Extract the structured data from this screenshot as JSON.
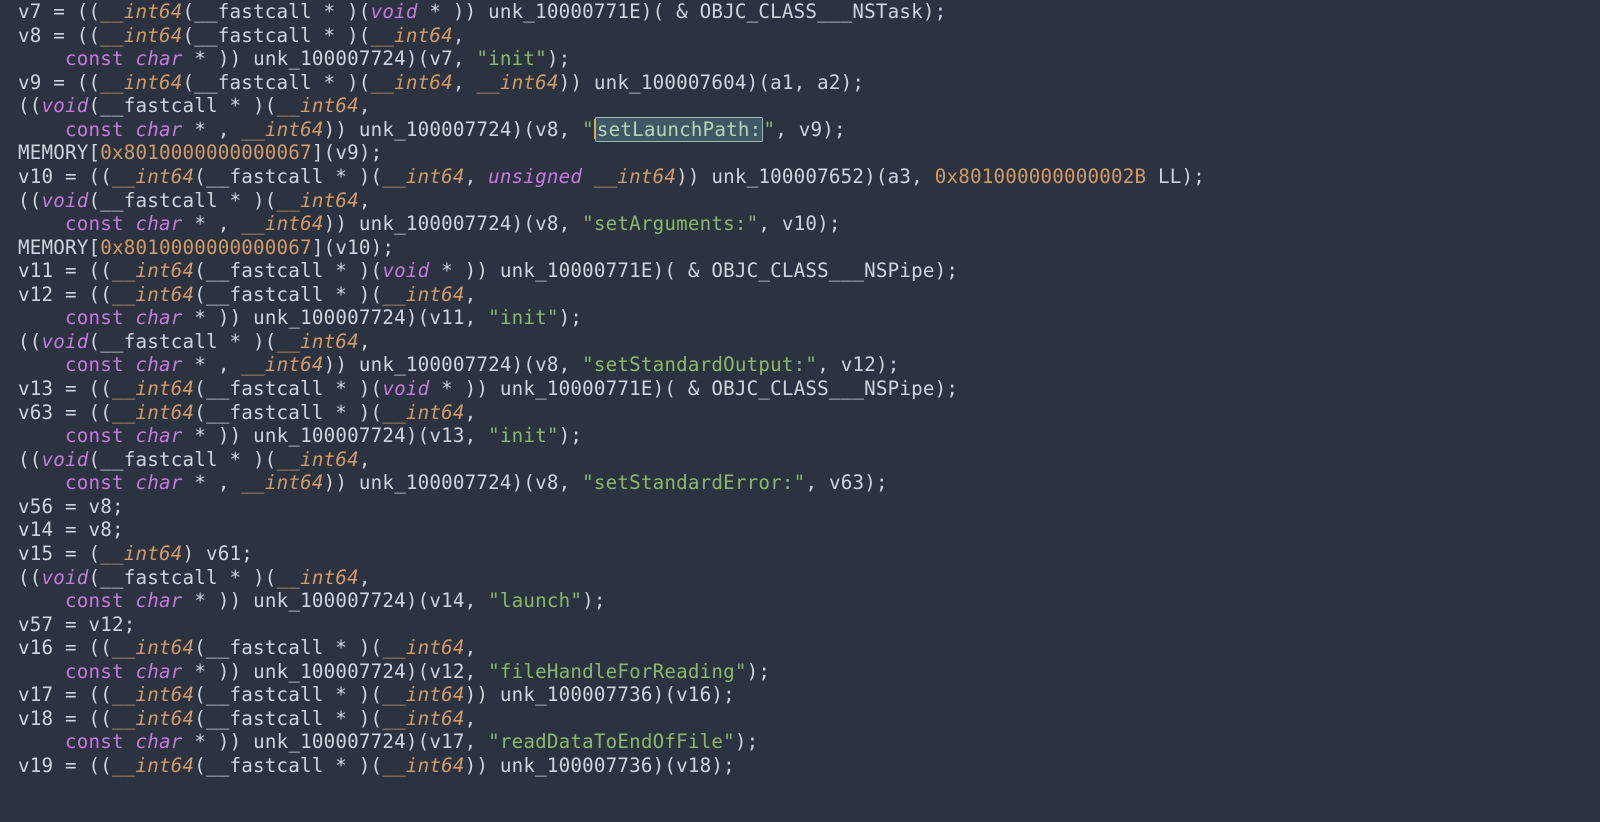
{
  "colors": {
    "background": "#2b3340",
    "foreground": "#cfd4dc",
    "type": "#d19a66",
    "keyword": "#c778dd",
    "string": "#89b86a",
    "number": "#d19a66",
    "highlight_bg": "#3e5866",
    "caret": "#e5a24a"
  },
  "highlighted_text": "setLaunchPath:",
  "code_lines": [
    [
      [
        "default",
        "v7 = (("
      ],
      [
        "type",
        "__int64"
      ],
      [
        "default",
        "(__fastcall * )("
      ],
      [
        "void",
        "void"
      ],
      [
        "default",
        " * )) unk_10000771E)( "
      ],
      [
        "amp",
        "&"
      ],
      [
        "default",
        " OBJC_CLASS___NSTask);"
      ]
    ],
    [
      [
        "default",
        "v8 = (("
      ],
      [
        "type",
        "__int64"
      ],
      [
        "default",
        "(__fastcall * )("
      ],
      [
        "type",
        "__int64"
      ],
      [
        "default",
        ","
      ]
    ],
    [
      [
        "default",
        "    "
      ],
      [
        "kw",
        "const"
      ],
      [
        "default",
        " "
      ],
      [
        "char",
        "char"
      ],
      [
        "default",
        " * )) unk_100007724)(v7, "
      ],
      [
        "str",
        "\"init\""
      ],
      [
        "default",
        ");"
      ]
    ],
    [
      [
        "default",
        "v9 = (("
      ],
      [
        "type",
        "__int64"
      ],
      [
        "default",
        "(__fastcall * )("
      ],
      [
        "type",
        "__int64"
      ],
      [
        "default",
        ", "
      ],
      [
        "type",
        "__int64"
      ],
      [
        "default",
        ")) unk_100007604)(a1, a2);"
      ]
    ],
    [
      [
        "default",
        "(("
      ],
      [
        "void",
        "void"
      ],
      [
        "default",
        "(__fastcall * )("
      ],
      [
        "type",
        "__int64"
      ],
      [
        "default",
        ","
      ]
    ],
    [
      [
        "default",
        "    "
      ],
      [
        "kw",
        "const"
      ],
      [
        "default",
        " "
      ],
      [
        "char",
        "char"
      ],
      [
        "default",
        " * , "
      ],
      [
        "type",
        "__int64"
      ],
      [
        "default",
        ")) unk_100007724)(v8, "
      ],
      [
        "str",
        "\""
      ],
      [
        "caret",
        ""
      ],
      [
        "hl",
        "setLaunchPath:"
      ],
      [
        "str",
        "\""
      ],
      [
        "default",
        ", v9);"
      ]
    ],
    [
      [
        "default",
        "MEMORY["
      ],
      [
        "num",
        "0x8010000000000067"
      ],
      [
        "default",
        "](v9);"
      ]
    ],
    [
      [
        "default",
        "v10 = (("
      ],
      [
        "type",
        "__int64"
      ],
      [
        "default",
        "(__fastcall * )("
      ],
      [
        "type",
        "__int64"
      ],
      [
        "default",
        ", "
      ],
      [
        "unsigned",
        "unsigned"
      ],
      [
        "default",
        " "
      ],
      [
        "type",
        "__int64"
      ],
      [
        "default",
        ")) unk_100007652)(a3, "
      ],
      [
        "num",
        "0x801000000000002B"
      ],
      [
        "default",
        " LL);"
      ]
    ],
    [
      [
        "default",
        "(("
      ],
      [
        "void",
        "void"
      ],
      [
        "default",
        "(__fastcall * )("
      ],
      [
        "type",
        "__int64"
      ],
      [
        "default",
        ","
      ]
    ],
    [
      [
        "default",
        "    "
      ],
      [
        "kw",
        "const"
      ],
      [
        "default",
        " "
      ],
      [
        "char",
        "char"
      ],
      [
        "default",
        " * , "
      ],
      [
        "type",
        "__int64"
      ],
      [
        "default",
        ")) unk_100007724)(v8, "
      ],
      [
        "str",
        "\"setArguments:\""
      ],
      [
        "default",
        ", v10);"
      ]
    ],
    [
      [
        "default",
        "MEMORY["
      ],
      [
        "num",
        "0x8010000000000067"
      ],
      [
        "default",
        "](v10);"
      ]
    ],
    [
      [
        "default",
        "v11 = (("
      ],
      [
        "type",
        "__int64"
      ],
      [
        "default",
        "(__fastcall * )("
      ],
      [
        "void",
        "void"
      ],
      [
        "default",
        " * )) unk_10000771E)( "
      ],
      [
        "amp",
        "&"
      ],
      [
        "default",
        " OBJC_CLASS___NSPipe);"
      ]
    ],
    [
      [
        "default",
        "v12 = (("
      ],
      [
        "type",
        "__int64"
      ],
      [
        "default",
        "(__fastcall * )("
      ],
      [
        "type",
        "__int64"
      ],
      [
        "default",
        ","
      ]
    ],
    [
      [
        "default",
        "    "
      ],
      [
        "kw",
        "const"
      ],
      [
        "default",
        " "
      ],
      [
        "char",
        "char"
      ],
      [
        "default",
        " * )) unk_100007724)(v11, "
      ],
      [
        "str",
        "\"init\""
      ],
      [
        "default",
        ");"
      ]
    ],
    [
      [
        "default",
        "(("
      ],
      [
        "void",
        "void"
      ],
      [
        "default",
        "(__fastcall * )("
      ],
      [
        "type",
        "__int64"
      ],
      [
        "default",
        ","
      ]
    ],
    [
      [
        "default",
        "    "
      ],
      [
        "kw",
        "const"
      ],
      [
        "default",
        " "
      ],
      [
        "char",
        "char"
      ],
      [
        "default",
        " * , "
      ],
      [
        "type",
        "__int64"
      ],
      [
        "default",
        ")) unk_100007724)(v8, "
      ],
      [
        "str",
        "\"setStandardOutput:\""
      ],
      [
        "default",
        ", v12);"
      ]
    ],
    [
      [
        "default",
        "v13 = (("
      ],
      [
        "type",
        "__int64"
      ],
      [
        "default",
        "(__fastcall * )("
      ],
      [
        "void",
        "void"
      ],
      [
        "default",
        " * )) unk_10000771E)( "
      ],
      [
        "amp",
        "&"
      ],
      [
        "default",
        " OBJC_CLASS___NSPipe);"
      ]
    ],
    [
      [
        "default",
        "v63 = (("
      ],
      [
        "type",
        "__int64"
      ],
      [
        "default",
        "(__fastcall * )("
      ],
      [
        "type",
        "__int64"
      ],
      [
        "default",
        ","
      ]
    ],
    [
      [
        "default",
        "    "
      ],
      [
        "kw",
        "const"
      ],
      [
        "default",
        " "
      ],
      [
        "char",
        "char"
      ],
      [
        "default",
        " * )) unk_100007724)(v13, "
      ],
      [
        "str",
        "\"init\""
      ],
      [
        "default",
        ");"
      ]
    ],
    [
      [
        "default",
        "(("
      ],
      [
        "void",
        "void"
      ],
      [
        "default",
        "(__fastcall * )("
      ],
      [
        "type",
        "__int64"
      ],
      [
        "default",
        ","
      ]
    ],
    [
      [
        "default",
        "    "
      ],
      [
        "kw",
        "const"
      ],
      [
        "default",
        " "
      ],
      [
        "char",
        "char"
      ],
      [
        "default",
        " * , "
      ],
      [
        "type",
        "__int64"
      ],
      [
        "default",
        ")) unk_100007724)(v8, "
      ],
      [
        "str",
        "\"setStandardError:\""
      ],
      [
        "default",
        ", v63);"
      ]
    ],
    [
      [
        "default",
        "v56 = v8;"
      ]
    ],
    [
      [
        "default",
        "v14 = v8;"
      ]
    ],
    [
      [
        "default",
        "v15 = ("
      ],
      [
        "type",
        "__int64"
      ],
      [
        "default",
        ") v61;"
      ]
    ],
    [
      [
        "default",
        "(("
      ],
      [
        "void",
        "void"
      ],
      [
        "default",
        "(__fastcall * )("
      ],
      [
        "type",
        "__int64"
      ],
      [
        "default",
        ","
      ]
    ],
    [
      [
        "default",
        "    "
      ],
      [
        "kw",
        "const"
      ],
      [
        "default",
        " "
      ],
      [
        "char",
        "char"
      ],
      [
        "default",
        " * )) unk_100007724)(v14, "
      ],
      [
        "str",
        "\"launch\""
      ],
      [
        "default",
        ");"
      ]
    ],
    [
      [
        "default",
        "v57 = v12;"
      ]
    ],
    [
      [
        "default",
        "v16 = (("
      ],
      [
        "type",
        "__int64"
      ],
      [
        "default",
        "(__fastcall * )("
      ],
      [
        "type",
        "__int64"
      ],
      [
        "default",
        ","
      ]
    ],
    [
      [
        "default",
        "    "
      ],
      [
        "kw",
        "const"
      ],
      [
        "default",
        " "
      ],
      [
        "char",
        "char"
      ],
      [
        "default",
        " * )) unk_100007724)(v12, "
      ],
      [
        "str",
        "\"fileHandleForReading\""
      ],
      [
        "default",
        ");"
      ]
    ],
    [
      [
        "default",
        "v17 = (("
      ],
      [
        "type",
        "__int64"
      ],
      [
        "default",
        "(__fastcall * )("
      ],
      [
        "type",
        "__int64"
      ],
      [
        "default",
        ")) unk_100007736)(v16);"
      ]
    ],
    [
      [
        "default",
        "v18 = (("
      ],
      [
        "type",
        "__int64"
      ],
      [
        "default",
        "(__fastcall * )("
      ],
      [
        "type",
        "__int64"
      ],
      [
        "default",
        ","
      ]
    ],
    [
      [
        "default",
        "    "
      ],
      [
        "kw",
        "const"
      ],
      [
        "default",
        " "
      ],
      [
        "char",
        "char"
      ],
      [
        "default",
        " * )) unk_100007724)(v17, "
      ],
      [
        "str",
        "\"readDataToEndOfFile\""
      ],
      [
        "default",
        ");"
      ]
    ],
    [
      [
        "default",
        "v19 = (("
      ],
      [
        "type",
        "__int64"
      ],
      [
        "default",
        "(__fastcall * )("
      ],
      [
        "type",
        "__int64"
      ],
      [
        "default",
        ")) unk_100007736)(v18);"
      ]
    ]
  ]
}
